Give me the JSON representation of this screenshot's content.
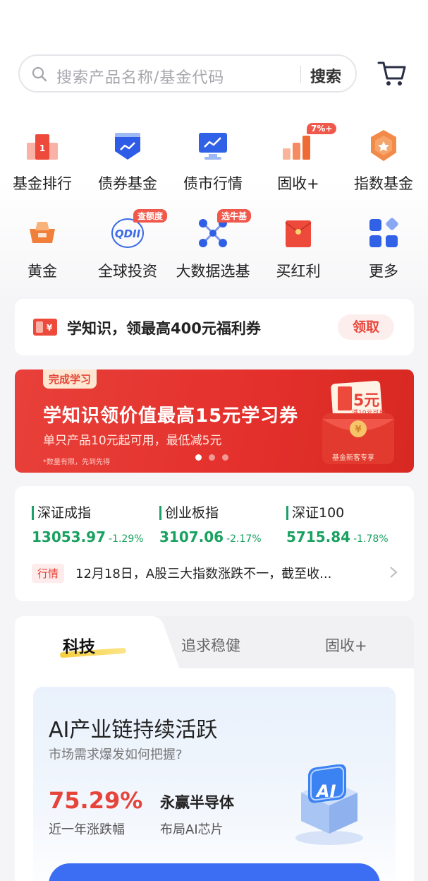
{
  "search": {
    "placeholder": "搜索产品名称/基金代码",
    "button": "搜索"
  },
  "categories": [
    {
      "label": "基金排行",
      "icon": "ranking-icon"
    },
    {
      "label": "债券基金",
      "icon": "bond-fund-icon"
    },
    {
      "label": "债市行情",
      "icon": "bond-market-icon"
    },
    {
      "label": "固收+",
      "icon": "fixed-income-icon",
      "badge": "7%+"
    },
    {
      "label": "指数基金",
      "icon": "index-fund-icon"
    },
    {
      "label": "黄金",
      "icon": "gold-icon"
    },
    {
      "label": "全球投资",
      "icon": "qdii-icon",
      "badge": "查额度"
    },
    {
      "label": "大数据选基",
      "icon": "big-data-icon",
      "badge": "选牛基"
    },
    {
      "label": "买红利",
      "icon": "dividend-icon"
    },
    {
      "label": "更多",
      "icon": "more-icon"
    }
  ],
  "promo": {
    "text": "学知识，领最高400元福利券",
    "button": "领取"
  },
  "banner": {
    "tag": "完成学习",
    "title": "学知识领价值最高15元学习券",
    "subtitle": "单只产品10元起可用，最低减5元",
    "note": "*数量有限，先到先得",
    "coupon_amount": "5元",
    "coupon_condition": "满10元可用",
    "coupon_label": "基金新客专享",
    "slide_count": 3,
    "active_slide": 1
  },
  "market": {
    "indices": [
      {
        "name": "深证成指",
        "value": "13053.97",
        "change": "-1.29%"
      },
      {
        "name": "创业板指",
        "value": "3107.06",
        "change": "-2.17%"
      },
      {
        "name": "深证100",
        "value": "5715.84",
        "change": "-1.78%"
      }
    ],
    "news_tag": "行情",
    "news_text": "12月18日，A股三大指数涨跌不一，截至收..."
  },
  "tabs": [
    {
      "label": "科技",
      "active": true
    },
    {
      "label": "追求稳健",
      "active": false
    },
    {
      "label": "固收+",
      "active": false
    }
  ],
  "feature": {
    "title": "AI产业链持续活跃",
    "subtitle": "市场需求爆发如何把握?",
    "percent": "75.29%",
    "percent_label": "近一年涨跌幅",
    "fund_name": "永赢半导体",
    "fund_desc": "布局AI芯片",
    "cube_text": "AI"
  },
  "colors": {
    "accent_red": "#e6433a",
    "down_green": "#18a15f",
    "primary_blue": "#3b6ef2"
  }
}
